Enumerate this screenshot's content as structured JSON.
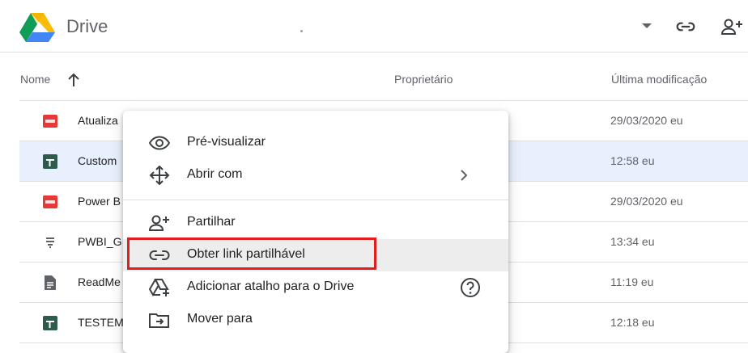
{
  "app": {
    "title": "Drive",
    "accent": "#1a73e8"
  },
  "header": {
    "icons": [
      "chevron-down-icon",
      "link-icon",
      "add-person-icon"
    ]
  },
  "columns": {
    "name": "Nome",
    "owner": "Proprietário",
    "modified": "Última modificação"
  },
  "rows": [
    {
      "name": "Atualiza",
      "modified": "29/03/2020 eu",
      "icon": "pdf-icon",
      "selected": false
    },
    {
      "name": "Custom",
      "modified": "12:58 eu",
      "icon": "sheets-icon",
      "selected": true
    },
    {
      "name": "Power B",
      "modified": "29/03/2020 eu",
      "icon": "pdf-icon",
      "selected": false
    },
    {
      "name": "PWBI_G",
      "modified": "13:34 eu",
      "icon": "generic-file-icon",
      "selected": false
    },
    {
      "name": "ReadMe",
      "modified": "11:19 eu",
      "icon": "doc-icon",
      "selected": false
    },
    {
      "name": "TESTEM",
      "modified": "12:18 eu",
      "icon": "sheets-icon",
      "selected": false
    }
  ],
  "context_menu": {
    "items": [
      {
        "label": "Pré-visualizar",
        "icon": "eye-icon"
      },
      {
        "label": "Abrir com",
        "icon": "open-with-icon",
        "submenu": true
      },
      {
        "label": "Partilhar",
        "icon": "add-person-icon"
      },
      {
        "label": "Obter link partilhável",
        "icon": "link-icon",
        "highlighted": true
      },
      {
        "label": "Adicionar atalho para o Drive",
        "icon": "drive-shortcut-icon",
        "help": true
      },
      {
        "label": "Mover para",
        "icon": "move-folder-icon"
      }
    ],
    "highlight_color": "#e01e1e"
  }
}
